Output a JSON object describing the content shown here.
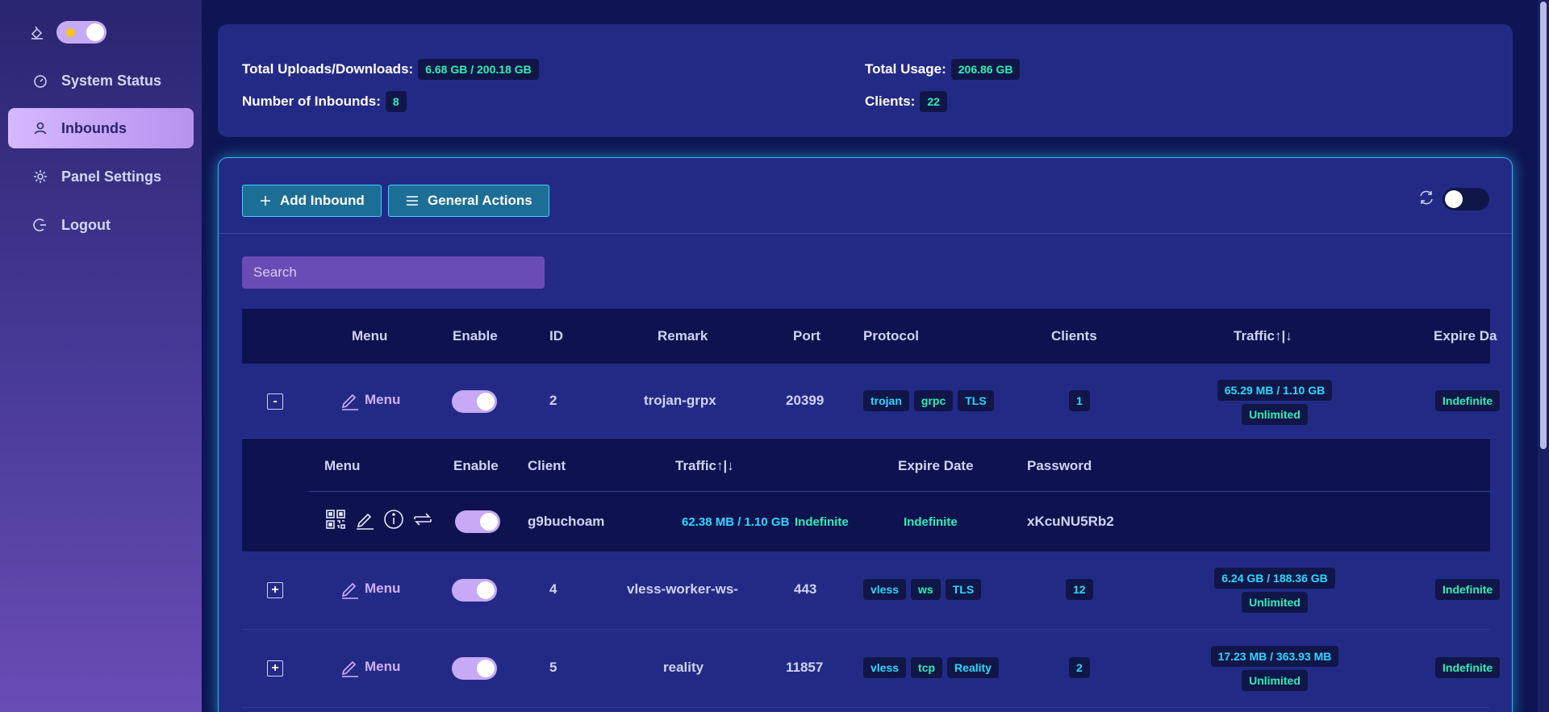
{
  "sidebar": {
    "items": [
      {
        "label": "System Status",
        "icon": "dashboard-icon"
      },
      {
        "label": "Inbounds",
        "icon": "user-icon",
        "active": true
      },
      {
        "label": "Panel Settings",
        "icon": "gear-icon"
      },
      {
        "label": "Logout",
        "icon": "logout-icon"
      }
    ]
  },
  "stats": {
    "uploads_label": "Total Uploads/Downloads:",
    "uploads_value": "6.68 GB / 200.18 GB",
    "inbounds_label": "Number of Inbounds:",
    "inbounds_value": "8",
    "usage_label": "Total Usage:",
    "usage_value": "206.86 GB",
    "clients_label": "Clients:",
    "clients_value": "22"
  },
  "toolbar": {
    "add_label": "Add Inbound",
    "actions_label": "General Actions"
  },
  "search": {
    "placeholder": "Search"
  },
  "table": {
    "headers": {
      "menu": "Menu",
      "enable": "Enable",
      "id": "ID",
      "remark": "Remark",
      "port": "Port",
      "protocol": "Protocol",
      "clients": "Clients",
      "traffic": "Traffic↑|↓",
      "expire": "Expire Da"
    },
    "rows": [
      {
        "expand": "-",
        "menu": "Menu",
        "id": "2",
        "remark": "trojan-grpx",
        "port": "20399",
        "protocol": [
          "trojan",
          "grpc",
          "TLS"
        ],
        "clients": "1",
        "traffic": "65.29 MB / 1.10 GB",
        "limit": "Unlimited",
        "expire": "Indefinite"
      },
      {
        "expand": "+",
        "menu": "Menu",
        "id": "4",
        "remark": "vless-worker-ws-",
        "port": "443",
        "protocol": [
          "vless",
          "ws",
          "TLS"
        ],
        "clients": "12",
        "traffic": "6.24 GB / 188.36 GB",
        "limit": "Unlimited",
        "expire": "Indefinite"
      },
      {
        "expand": "+",
        "menu": "Menu",
        "id": "5",
        "remark": "reality",
        "port": "11857",
        "protocol": [
          "vless",
          "tcp",
          "Reality"
        ],
        "clients": "2",
        "traffic": "17.23 MB / 363.93 MB",
        "limit": "Unlimited",
        "expire": "Indefinite"
      }
    ]
  },
  "client_table": {
    "headers": {
      "menu": "Menu",
      "enable": "Enable",
      "client": "Client",
      "traffic": "Traffic↑|↓",
      "expire": "Expire Date",
      "password": "Password"
    },
    "row": {
      "client": "g9buchoam",
      "traffic": "62.38 MB / 1.10 GB",
      "traffic_limit": "Indefinite",
      "expire": "Indefinite",
      "password": "xKcuNU5Rb2"
    }
  }
}
